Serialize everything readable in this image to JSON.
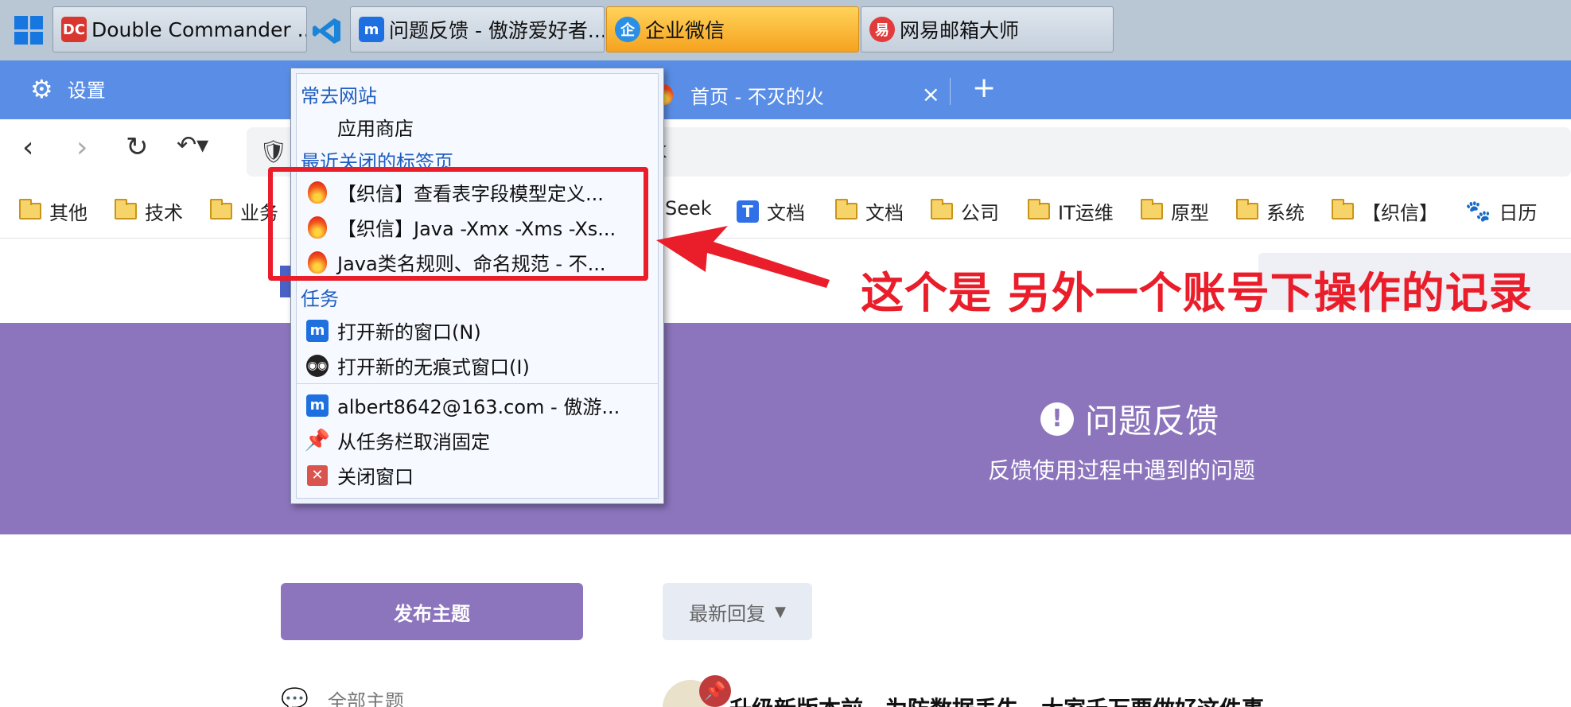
{
  "taskbar": {
    "buttons": [
      {
        "label": "Double Commander ...",
        "icon": "double-commander-icon"
      },
      {
        "label": "问题反馈 - 傲游爱好者...",
        "icon": "maxthon-icon"
      },
      {
        "label": "企业微信",
        "icon": "wecom-icon"
      },
      {
        "label": "网易邮箱大师",
        "icon": "netease-mail-icon"
      }
    ],
    "active_color": "#f6a21f"
  },
  "browser": {
    "settings_label": "设置",
    "active_tab_title": "首页 - 不灭的火",
    "tab_close_glyph": "×",
    "new_tab_glyph": "+",
    "address_text": "k",
    "tab_strip_color": "#5a8ee6"
  },
  "bookmarks": [
    {
      "label": "其他",
      "type": "folder"
    },
    {
      "label": "技术",
      "type": "folder"
    },
    {
      "label": "业务",
      "type": "folder"
    },
    {
      "label": "Seek",
      "type": "text"
    },
    {
      "label": "文档",
      "type": "doc"
    },
    {
      "label": "文档",
      "type": "folder"
    },
    {
      "label": "公司",
      "type": "folder"
    },
    {
      "label": "IT运维",
      "type": "folder"
    },
    {
      "label": "原型",
      "type": "folder"
    },
    {
      "label": "系统",
      "type": "folder"
    },
    {
      "label": "【织信】",
      "type": "folder"
    },
    {
      "label": "日历",
      "type": "paw"
    }
  ],
  "jumplist": {
    "frequent_header": "常去网站",
    "frequent_items": [
      "应用商店"
    ],
    "recent_header": "最近关闭的标签页",
    "recent_items": [
      "【织信】查看表字段模型定义...",
      "【织信】Java -Xmx -Xms -Xs...",
      "Java类名规则、命名规范 - 不..."
    ],
    "tasks_header": "任务",
    "tasks": [
      "打开新的窗口(N)",
      "打开新的无痕式窗口(I)"
    ],
    "app_items": [
      "albert8642@163.com - 傲游...",
      "从任务栏取消固定",
      "关闭窗口"
    ]
  },
  "annotation": {
    "text": "这个是 另外一个账号下操作的记录",
    "color": "#ea1e2a"
  },
  "page": {
    "hero_title": "问题反馈",
    "hero_subtitle": "反馈使用过程中遇到的问题",
    "publish_button": "发布主题",
    "sort_button": "最新回复",
    "all_topics": "全部主题",
    "post_title": "升级新版本前，为防数据丢失，大家千万要做好这件事。",
    "accent_color": "#8c75bd"
  }
}
